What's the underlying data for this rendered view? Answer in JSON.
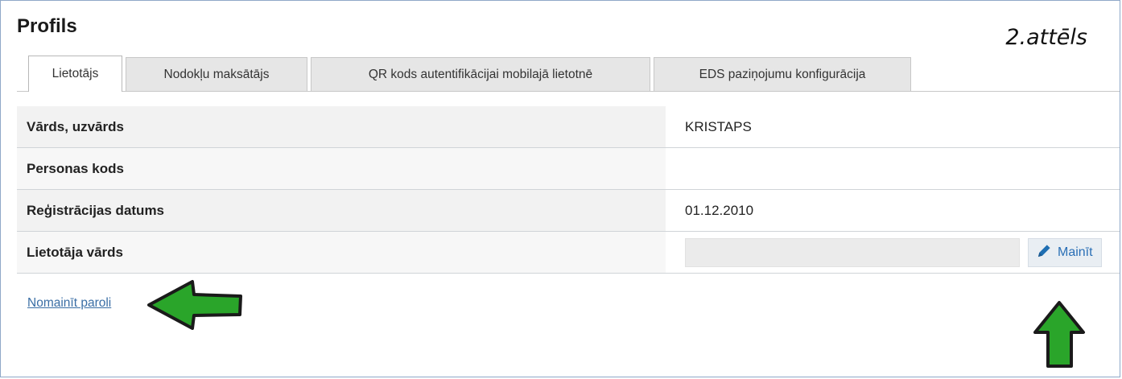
{
  "page": {
    "title": "Profils",
    "figure_label": "2.attēls"
  },
  "tabs": [
    {
      "label": "Lietotājs",
      "active": true
    },
    {
      "label": "Nodokļu maksātājs",
      "active": false
    },
    {
      "label": "QR kods autentifikācijai mobilajā lietotnē",
      "active": false
    },
    {
      "label": "EDS paziņojumu konfigurācija",
      "active": false
    }
  ],
  "profile": {
    "rows": [
      {
        "label": "Vārds, uzvārds",
        "value": "KRISTAPS"
      },
      {
        "label": "Personas kods",
        "value": ""
      },
      {
        "label": "Reģistrācijas datums",
        "value": "01.12.2010"
      },
      {
        "label": "Lietotāja vārds",
        "value": ""
      }
    ],
    "username_value": "",
    "change_label": "Mainīt"
  },
  "links": {
    "change_password": "Nomainīt paroli"
  },
  "colors": {
    "link": "#3a6ea5",
    "arrow_fill": "#2aa52a",
    "arrow_outline": "#1a1a1a",
    "accent": "#2a6fb6"
  },
  "icons": {
    "edit": "pencil-icon",
    "annotation_left": "green-arrow-left",
    "annotation_up": "green-arrow-up"
  }
}
